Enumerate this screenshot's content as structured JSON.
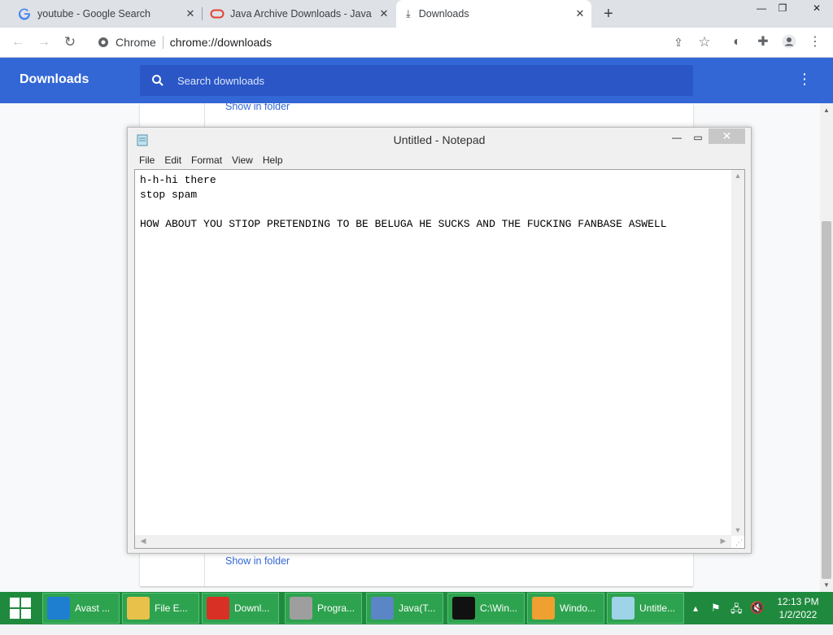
{
  "browser": {
    "tabs": [
      {
        "label": "youtube - Google Search",
        "icon": "google-icon"
      },
      {
        "label": "Java Archive Downloads - Java SE",
        "icon": "oracle-icon"
      },
      {
        "label": "Downloads",
        "icon": "download-icon",
        "active": true
      }
    ],
    "omnibox": {
      "site_label": "Chrome",
      "url": "chrome://downloads"
    }
  },
  "downloads_page": {
    "title": "Downloads",
    "search_placeholder": "Search downloads",
    "show_in_folder": "Show in folder"
  },
  "notepad": {
    "title": "Untitled - Notepad",
    "menu": [
      "File",
      "Edit",
      "Format",
      "View",
      "Help"
    ],
    "text": "h-h-hi there\nstop spam\n\nHOW ABOUT YOU STIOP PRETENDING TO BE BELUGA HE SUCKS AND THE FUCKING FANBASE ASWELL"
  },
  "taskbar": {
    "buttons": [
      {
        "label": "Avast ...",
        "icon": "edge-icon",
        "color": "#1e7fd0"
      },
      {
        "label": "File E...",
        "icon": "folder-icon",
        "color": "#e8c14a"
      },
      {
        "label": "Downl...",
        "icon": "chrome-icon",
        "color": "#d93025"
      },
      {
        "label": "Progra...",
        "icon": "programs-icon",
        "color": "#9e9e9e"
      },
      {
        "label": "Java(T...",
        "icon": "java-icon",
        "color": "#5a86c5"
      },
      {
        "label": "C:\\Win...",
        "icon": "cmd-icon",
        "color": "#111111"
      },
      {
        "label": "Windo...",
        "icon": "virtualbox-icon",
        "color": "#f0a030"
      },
      {
        "label": "Untitle...",
        "icon": "notepad-icon",
        "color": "#9fd3e8"
      }
    ],
    "clock": {
      "time": "12:13 PM",
      "date": "1/2/2022"
    }
  },
  "colors": {
    "chrome_blue": "#3367d6",
    "taskbar_green": "#1f8a3d"
  }
}
